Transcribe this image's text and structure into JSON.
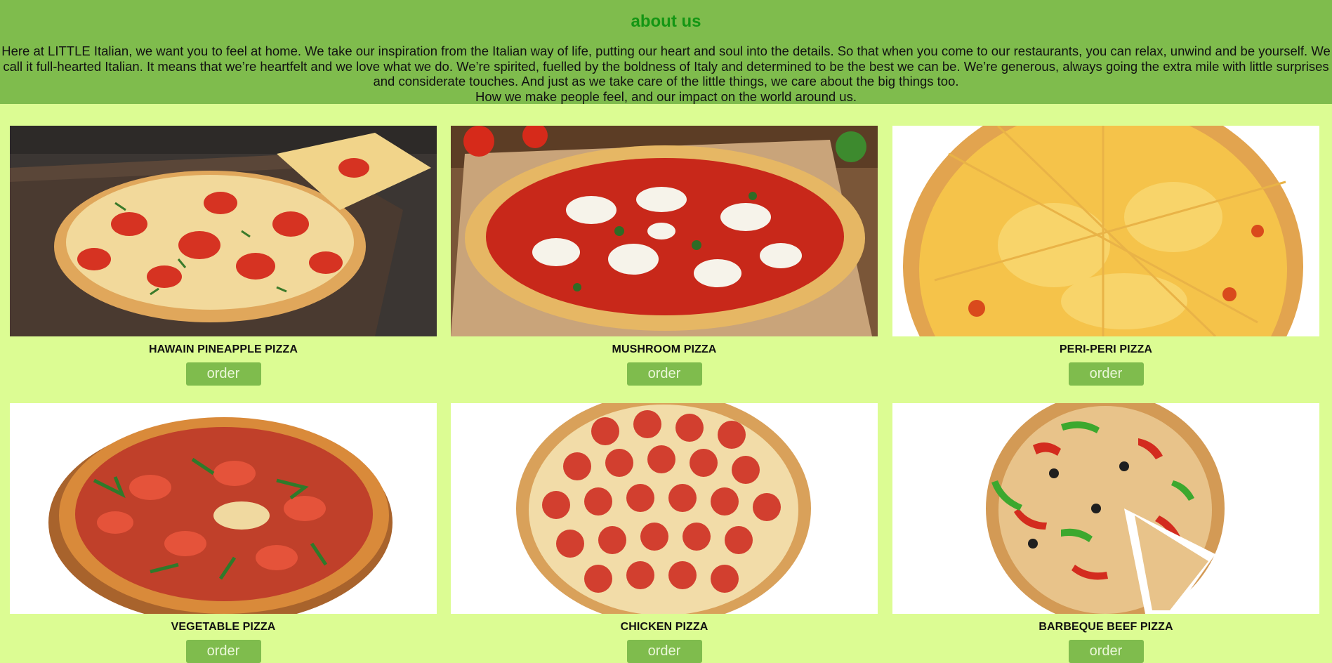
{
  "about": {
    "title": "about us",
    "paragraph": "Here at LITTLE Italian, we want you to feel at home. We take our inspiration from the Italian way of life, putting our heart and soul into the details. So that when you come to our restaurants, you can relax, unwind and be yourself. We call it full-hearted Italian. It means that we’re heartfelt and we love what we do. We’re spirited, fuelled by the boldness of Italy and determined to be the best we can be. We’re generous, always going the extra mile with little surprises and considerate touches. And just as we take care of the little things, we care about the big things too.",
    "tagline": "How we make people feel, and our impact on the world around us."
  },
  "menu": {
    "items": [
      {
        "name": "HAWAIN PINEAPPLE PIZZA",
        "order_label": "order",
        "image": "tomato-basil-pizza-on-board"
      },
      {
        "name": "MUSHROOM PIZZA",
        "order_label": "order",
        "image": "margherita-pizza-on-wood"
      },
      {
        "name": "PERI-PERI PIZZA",
        "order_label": "order",
        "image": "cheese-pizza-white-background"
      },
      {
        "name": "VEGETABLE PIZZA",
        "order_label": "order",
        "image": "arugula-tomato-pizza"
      },
      {
        "name": "CHICKEN PIZZA",
        "order_label": "order",
        "image": "pepperoni-pizza"
      },
      {
        "name": "BARBEQUE BEEF PIZZA",
        "order_label": "order",
        "image": "pepper-olive-pizza-sliced"
      }
    ]
  }
}
